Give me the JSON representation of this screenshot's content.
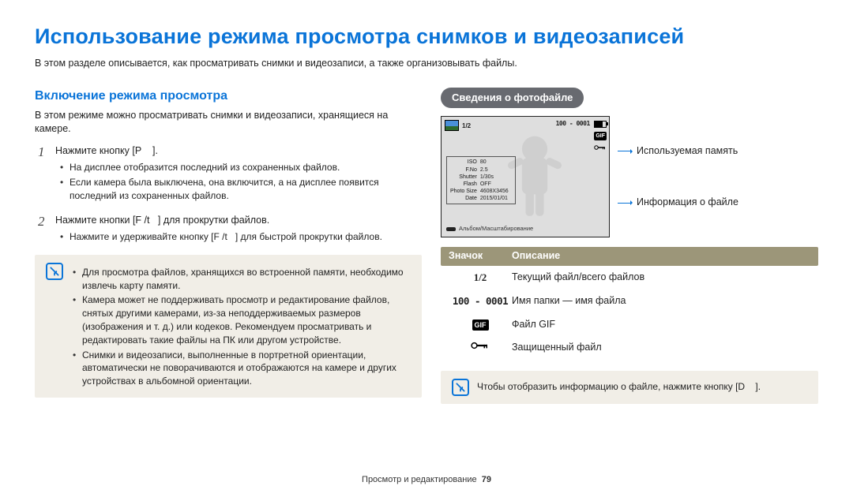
{
  "title": "Использование режима просмотра снимков и видеозаписей",
  "subtitle": "В этом разделе описывается, как просматривать снимки и видеозаписи, а также организовывать файлы.",
  "left": {
    "section_title": "Включение режима просмотра",
    "intro": "В этом режиме можно просматривать снимки и видеозаписи, хранящиеся на камере.",
    "step1_num": "1",
    "step1_text": "Нажмите кнопку [P    ].",
    "step1_bullets": [
      "На дисплее отобразится последний из сохраненных файлов.",
      "Если камера была выключена, она включится, а на дисплее появится последний из сохраненных файлов."
    ],
    "step2_num": "2",
    "step2_text": "Нажмите кнопки [F /t   ] для прокрутки файлов.",
    "step2_bullets": [
      "Нажмите и удерживайте кнопку [F /t   ] для быстрой прокрутки файлов."
    ],
    "note": [
      "Для просмотра файлов, хранящихся во встроенной памяти, необходимо извлечь карту памяти.",
      "Камера может не поддерживать просмотр и редактирование файлов, снятых другими камерами, из-за неподдерживаемых размеров (изображения и т. д.) или кодеков. Рекомендуем просматривать и редактировать такие файлы на ПК или другом устройстве.",
      "Снимки и видеозаписи, выполненные в портретной ориентации, автоматически не поворачиваются и отображаются на камере и других устройствах в альбомной ориентации."
    ]
  },
  "right": {
    "pill": "Сведения о фотофайле",
    "viewer": {
      "counter": "1/2",
      "folder": "100 - 0001",
      "gif": "GIF",
      "lock": "⚿",
      "info_rows": [
        [
          "ISO",
          "80"
        ],
        [
          "F.No",
          "2.5"
        ],
        [
          "Shutter",
          "1/30s"
        ],
        [
          "Flash",
          "OFF"
        ],
        [
          "Photo Size",
          "4608X3456"
        ],
        [
          "Date",
          "2015/01/01"
        ]
      ],
      "bottom": "Альбом/Масштабирование"
    },
    "callouts": {
      "memory": "Используемая память",
      "fileinfo": "Информация о файле"
    },
    "table": {
      "head_icon": "Значок",
      "head_desc": "Описание",
      "rows": {
        "counter_icon": "1/2",
        "counter_desc": "Текущий файл/всего файлов",
        "folder_icon": "100 - 0001",
        "folder_desc": "Имя папки — имя файла",
        "gif_icon": "GIF",
        "gif_desc": "Файл GIF",
        "lock_desc": "Защищенный файл"
      }
    },
    "tip": "Чтобы отобразить информацию о файле, нажмите кнопку [D    ]."
  },
  "footer": {
    "section": "Просмотр и редактирование",
    "page": "79"
  }
}
